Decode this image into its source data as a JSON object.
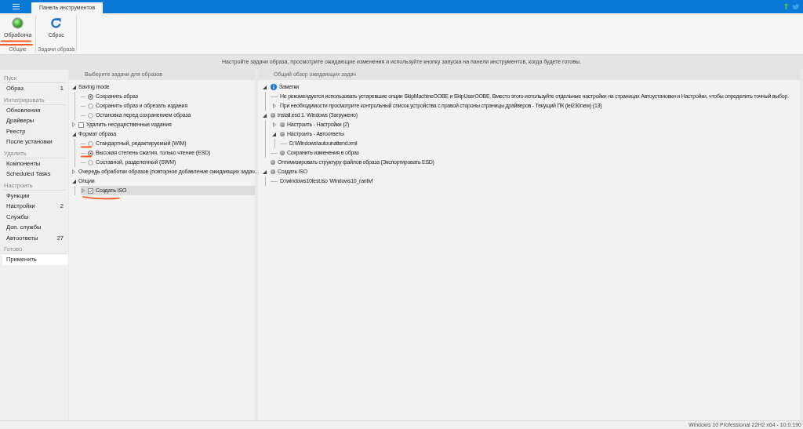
{
  "topbar": {
    "tabs": [
      {
        "label": "Панель инструментов",
        "selected": true
      }
    ]
  },
  "ribbon": {
    "groups": [
      {
        "label": "Общие",
        "buttons": [
          {
            "kind": "process",
            "label": "Обработка",
            "marked": true
          }
        ]
      },
      {
        "label": "Задачи образа",
        "buttons": [
          {
            "kind": "reset",
            "label": "Сброс",
            "marked": false
          }
        ]
      }
    ]
  },
  "hint": "Настройте задачи образа, просмотрите ожидающие изменения и используйте кнопку запуска на панели инструментов, когда будете готовы.",
  "sidebar": {
    "sections": [
      {
        "title": "Пуск",
        "items": [
          {
            "label": "Образ",
            "count": "1",
            "selected": false
          }
        ]
      },
      {
        "title": "Интегрировать",
        "items": [
          {
            "label": "Обновления",
            "selected": false
          },
          {
            "label": "Драйверы",
            "selected": false
          },
          {
            "label": "Реестр",
            "selected": false
          },
          {
            "label": "После установки",
            "selected": false
          }
        ]
      },
      {
        "title": "Удалить",
        "items": [
          {
            "label": "Компоненты",
            "selected": false
          },
          {
            "label": "Scheduled Tasks",
            "selected": false
          }
        ]
      },
      {
        "title": "Настроить",
        "items": [
          {
            "label": "Функции",
            "selected": false
          },
          {
            "label": "Настройки",
            "count": "2",
            "selected": false
          },
          {
            "label": "Службы",
            "selected": false
          },
          {
            "label": "Доп. службы",
            "selected": false
          },
          {
            "label": "Автоответы",
            "count": "27",
            "selected": false
          }
        ]
      },
      {
        "title": "Готово",
        "items": [
          {
            "label": "Применить",
            "selected": true
          }
        ]
      }
    ]
  },
  "task_panel": {
    "title": "Выберите задачи для образов",
    "tree": [
      {
        "kind": "group",
        "label": "Saving mode",
        "expanded": true,
        "children": [
          {
            "kind": "radio",
            "label": "Сохранить образ",
            "selected": true
          },
          {
            "kind": "radio",
            "label": "Сохранить образ и обрезать издания",
            "selected": false
          },
          {
            "kind": "radio",
            "label": "Остановка перед сохранением образа",
            "selected": false
          }
        ]
      },
      {
        "kind": "checkbox",
        "label": "Удалить несущественные издания",
        "checked": false,
        "expanded": false
      },
      {
        "kind": "group",
        "label": "Формат образа",
        "expanded": true,
        "children": [
          {
            "kind": "radio",
            "label": "Стандартный, редактируемый (WIM)",
            "selected": false,
            "marked": true
          },
          {
            "kind": "radio",
            "label": "Высокая степень сжатия, только чтение (ESD)",
            "selected": true,
            "marked": true
          },
          {
            "kind": "radio",
            "label": "Составной, разделенный (SWM)",
            "selected": false,
            "marked": false
          }
        ]
      },
      {
        "kind": "group",
        "label": "Очередь обработки образов (повторное добавление ожидающих задач...",
        "expanded": false
      },
      {
        "kind": "group",
        "label": "Опции",
        "expanded": true,
        "children": [
          {
            "kind": "checkbox",
            "label": "Создать ISO",
            "checked": true,
            "expanded": false,
            "highlighted": true,
            "marked": true
          }
        ]
      }
    ]
  },
  "overview_panel": {
    "title": "Общий обзор ожидающих задач",
    "tree": [
      {
        "kind": "info",
        "label": "Заметки",
        "expanded": true,
        "children": [
          {
            "kind": "text",
            "label": "Не рекомендуется использовать устаревшие опции SkipMachineOOBE и SkipUserOOBE. Вместо этого используйте отдельные настройки на страницах Автоустановки и Настройки, чтобы определить точный выбор."
          },
          {
            "kind": "text",
            "label": "При необходимости просмотрите контрольный список устройства с правой стороны страницы драйверов - Текущий ПК (lei230new) (13)",
            "expanded": false
          }
        ]
      },
      {
        "kind": "task",
        "label": "install.esd 1. Windows (Загружено)",
        "expanded": true,
        "children": [
          {
            "kind": "task",
            "label": "Настроить - Настройки (2)",
            "expanded": false
          },
          {
            "kind": "task",
            "label": "Настроить - Автоответы",
            "expanded": true,
            "children": [
              {
                "kind": "text",
                "label": "D:\\Windows\\autounattend.xml"
              }
            ]
          },
          {
            "kind": "task",
            "label": "Сохранить изменения в образ"
          }
        ]
      },
      {
        "kind": "task",
        "label": "Оптимизировать структуру файлов образа (Экспортировать ESD)"
      },
      {
        "kind": "task",
        "label": "Создать ISO",
        "expanded": true,
        "children": [
          {
            "kind": "text",
            "label": "D:\\windows10test.iso 'Windows10_rantivi'"
          }
        ]
      }
    ]
  },
  "status_bar": {
    "text": "Windows 10 Professional 22H2 x64 - 10.0.190"
  }
}
